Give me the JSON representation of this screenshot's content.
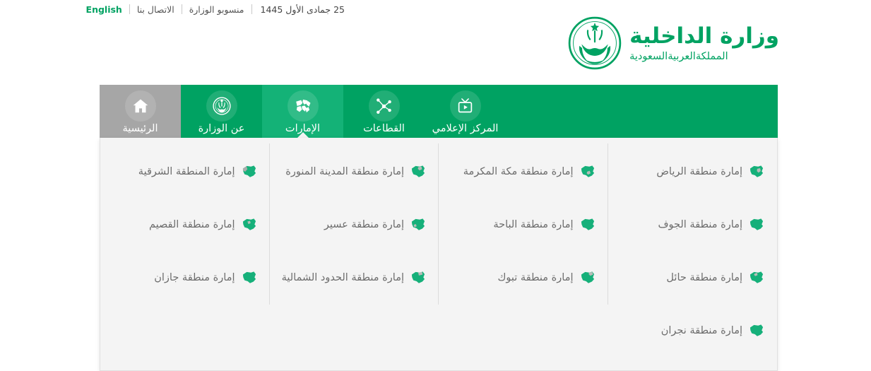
{
  "topbar": {
    "date": "25 جمادى الأول 1445",
    "links": [
      {
        "label": "منسوبو الوزارة"
      },
      {
        "label": "الاتصال بنا"
      },
      {
        "label": "English"
      }
    ]
  },
  "logo": {
    "title": "وزارة الداخلية",
    "subtitle": "المملكةالعربيةالسعودية",
    "emblem_icon": "saudi-emblem-icon",
    "color": "#00A262"
  },
  "nav": {
    "background": "#00A262",
    "active_background": "#14b277",
    "home_background": "#a6a6a6",
    "items": [
      {
        "label": "الرئيسية",
        "icon": "home-icon",
        "state": "home"
      },
      {
        "label": "عن الوزارة",
        "icon": "emblem-badge-icon",
        "state": "normal"
      },
      {
        "label": "الإمارات",
        "icon": "regions-map-icon",
        "state": "active"
      },
      {
        "label": "القطاعات",
        "icon": "network-share-icon",
        "state": "normal"
      },
      {
        "label": "المركز الإعلامي",
        "icon": "tv-media-icon",
        "state": "normal"
      }
    ]
  },
  "dropdown": {
    "background": "#f4f4f4",
    "item_icon": "saudi-map-icon",
    "columns": [
      {
        "items": [
          {
            "label": "إمارة منطقة الرياض"
          },
          {
            "label": "إمارة منطقة الجوف"
          },
          {
            "label": "إمارة منطقة حائل"
          },
          {
            "label": "إمارة منطقة نجران"
          }
        ]
      },
      {
        "items": [
          {
            "label": "إمارة منطقة مكة المكرمة"
          },
          {
            "label": "إمارة منطقة الباحة"
          },
          {
            "label": "إمارة منطقة تبوك"
          }
        ]
      },
      {
        "items": [
          {
            "label": "إمارة منطقة المدينة المنورة"
          },
          {
            "label": "إمارة منطقة عسير"
          },
          {
            "label": "إمارة منطقة الحدود الشمالية"
          }
        ]
      },
      {
        "items": [
          {
            "label": "إمارة المنطقة الشرقية"
          },
          {
            "label": "إمارة منطقة القصيم"
          },
          {
            "label": "إمارة منطقة جازان"
          }
        ]
      }
    ]
  }
}
